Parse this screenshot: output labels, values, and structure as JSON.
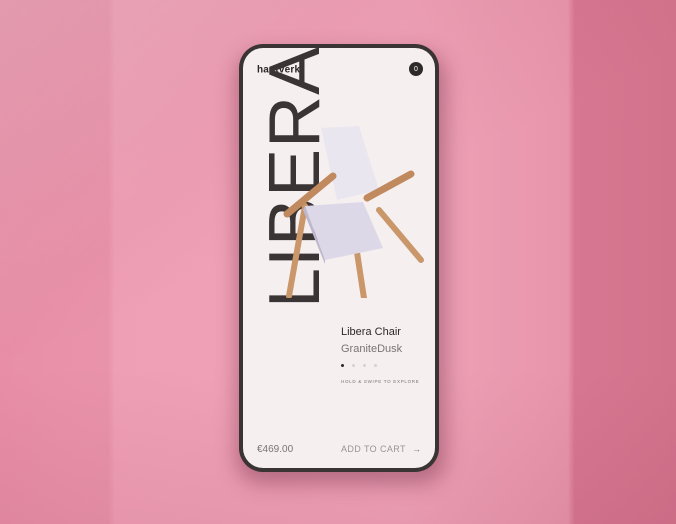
{
  "app": {
    "brand": "hantverk",
    "brand_mark": "®",
    "cart_count": "0"
  },
  "hero": {
    "big_word": "LIBERA",
    "product_title": "Libera Chair",
    "variant": "GraniteDusk",
    "hint": "HOLD & SWIPE TO EXPLORE",
    "carousel": {
      "count": 4,
      "active_index": 0
    }
  },
  "footer": {
    "price": "€469.00",
    "cta_label": "ADD TO CART",
    "cta_arrow": "→"
  },
  "colors": {
    "wall_pink": "#f0a3b8",
    "phone_frame": "#3a3435",
    "screen_bg": "#f6efef",
    "text_dark": "#2f2a2a"
  }
}
